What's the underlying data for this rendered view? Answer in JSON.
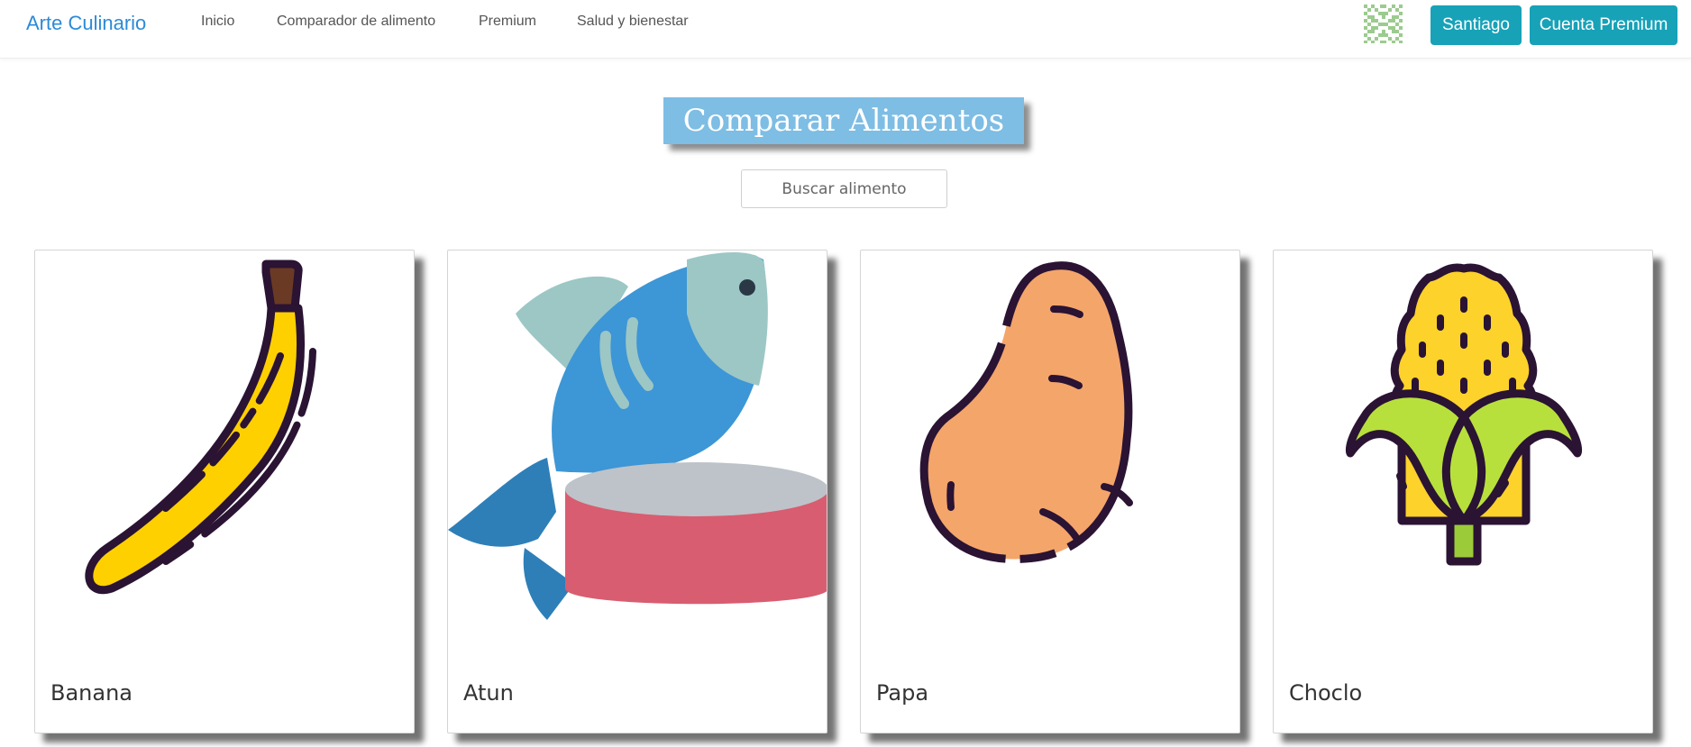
{
  "navbar": {
    "brand": "Arte Culinario",
    "links": [
      "Inicio",
      "Comparador de alimento",
      "Premium",
      "Salud y bienestar"
    ],
    "user_button": "Santiago",
    "premium_button": "Cuenta Premium",
    "accent_color": "#17a2b8",
    "brand_color": "#2b8ad8"
  },
  "main": {
    "title": "Comparar Alimentos",
    "title_bg_color": "#7ebde4",
    "search": {
      "placeholder": "Buscar alimento",
      "value": ""
    }
  },
  "foods": [
    {
      "name": "Banana",
      "icon": "banana-icon"
    },
    {
      "name": "Atun",
      "icon": "tuna-can-icon"
    },
    {
      "name": "Papa",
      "icon": "potato-icon"
    },
    {
      "name": "Choclo",
      "icon": "corn-icon"
    }
  ]
}
